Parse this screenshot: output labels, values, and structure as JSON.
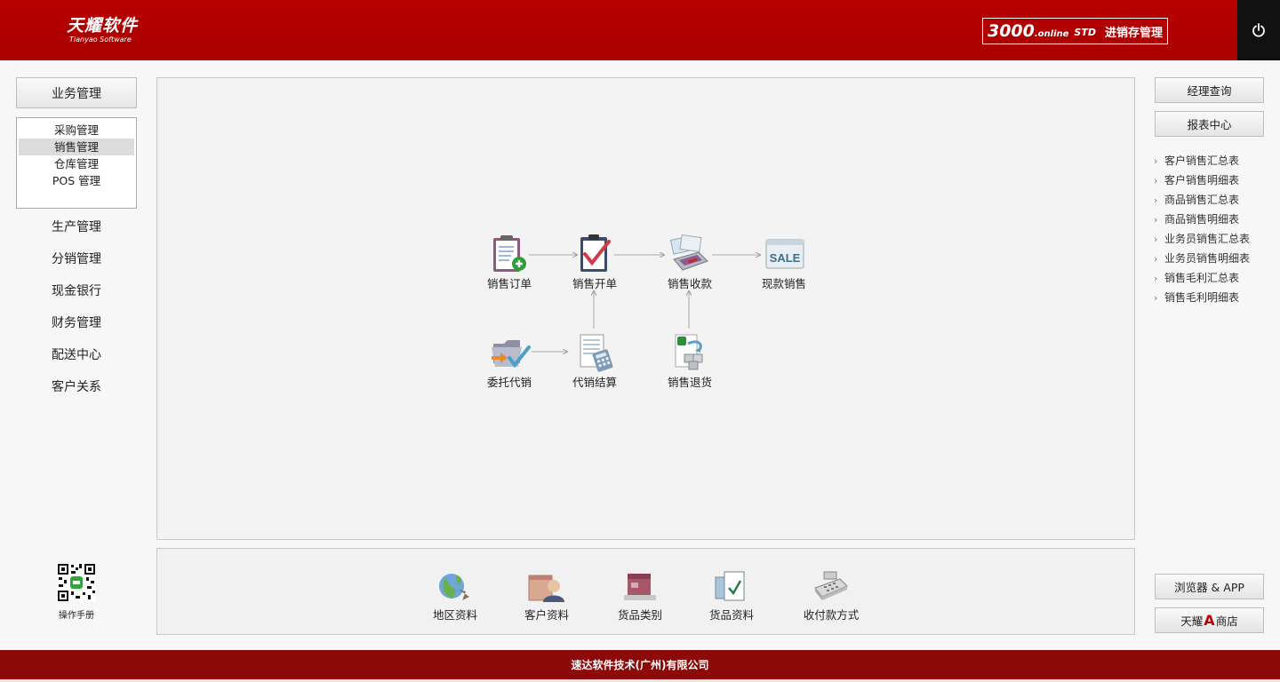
{
  "header": {
    "logo_main": "天耀软件",
    "logo_sub": "Tianyao Software",
    "edition_number": "3000",
    "edition_suffix": ".online",
    "edition_tier": "STD",
    "edition_name": "进销存管理",
    "accent_color": "#b00000"
  },
  "left_nav": {
    "section": "业务管理",
    "sub_items": [
      "采购管理",
      "销售管理",
      "仓库管理",
      "POS 管理"
    ],
    "active_sub_index": 1,
    "items": [
      "生产管理",
      "分销管理",
      "现金银行",
      "财务管理",
      "配送中心",
      "客户关系"
    ],
    "manual_label": "操作手册"
  },
  "flow": {
    "nodes": [
      {
        "label": "销售订单",
        "icon": "clipboard-add-icon"
      },
      {
        "label": "销售开单",
        "icon": "clipboard-check-icon"
      },
      {
        "label": "销售收款",
        "icon": "payment-terminal-icon"
      },
      {
        "label": "现款销售",
        "icon": "sale-sign-icon"
      },
      {
        "label": "委托代销",
        "icon": "folder-transfer-icon"
      },
      {
        "label": "代销结算",
        "icon": "calculator-sheet-icon"
      },
      {
        "label": "销售退货",
        "icon": "return-goods-icon"
      }
    ]
  },
  "base_data": {
    "items": [
      {
        "label": "地区资料",
        "icon": "globe-icon"
      },
      {
        "label": "客户资料",
        "icon": "customer-icon"
      },
      {
        "label": "货品类别",
        "icon": "goods-category-icon"
      },
      {
        "label": "货品资料",
        "icon": "goods-info-icon"
      },
      {
        "label": "收付款方式",
        "icon": "cash-register-icon"
      }
    ]
  },
  "right_nav": {
    "manager_query": "经理查询",
    "report_center": "报表中心",
    "reports": [
      "客户销售汇总表",
      "客户销售明细表",
      "商品销售汇总表",
      "商品销售明细表",
      "业务员销售汇总表",
      "业务员销售明细表",
      "销售毛利汇总表",
      "销售毛利明细表"
    ],
    "browser_app": "浏览器 & APP",
    "shop_prefix": "天耀",
    "shop_mark": "A",
    "shop_suffix": "商店"
  },
  "footer": {
    "company": "速达软件技术(广州)有限公司"
  }
}
